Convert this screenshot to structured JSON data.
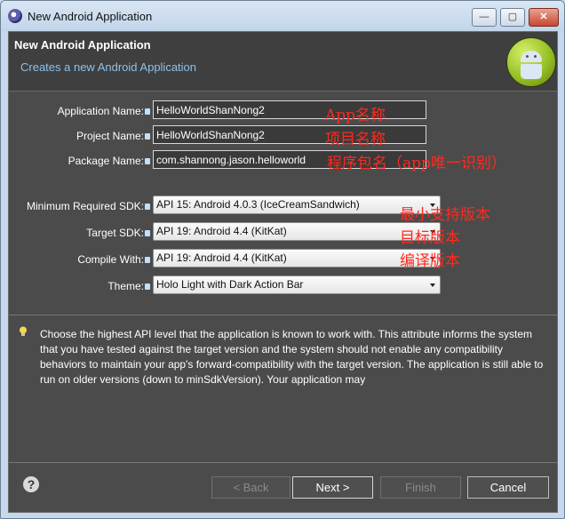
{
  "window": {
    "title": "New Android Application"
  },
  "window_buttons": {
    "minimize": "—",
    "maximize": "▢",
    "close": "✕"
  },
  "header": {
    "title": "New Android Application",
    "subtitle": "Creates a new Android Application"
  },
  "form": {
    "app_name": {
      "label": "Application Name:",
      "value": "HelloWorldShanNong2"
    },
    "project_name": {
      "label": "Project Name:",
      "value": "HelloWorldShanNong2"
    },
    "package_name": {
      "label": "Package Name:",
      "value": "com.shannong.jason.helloworld"
    },
    "min_sdk": {
      "label": "Minimum Required SDK:",
      "value": "API 15: Android 4.0.3 (IceCreamSandwich)"
    },
    "target_sdk": {
      "label": "Target SDK:",
      "value": "API 19: Android 4.4 (KitKat)"
    },
    "compile_with": {
      "label": "Compile With:",
      "value": "API 19: Android 4.4 (KitKat)"
    },
    "theme": {
      "label": "Theme:",
      "value": "Holo Light with Dark Action Bar"
    }
  },
  "annotations": {
    "app_name": "App名称",
    "project_name": "项目名称",
    "package_name": "程序包名（app唯一识别）",
    "min_sdk": "最小支持版本",
    "target_sdk": "目标版本",
    "compile_with": "编译版本"
  },
  "info": {
    "text": "Choose the highest API level that the application is known to work with. This attribute informs the system that you have tested against the target version and the system should not enable any compatibility behaviors to maintain your app's forward-compatibility with the target version. The application is still able to run on older versions (down to minSdkVersion). Your application may"
  },
  "buttons": {
    "help": "?",
    "back": "< Back",
    "next": "Next >",
    "finish": "Finish",
    "cancel": "Cancel"
  },
  "icons": {
    "app": "eclipse-icon",
    "logo": "android-logo",
    "info": "lightbulb-icon",
    "help": "help-icon"
  }
}
